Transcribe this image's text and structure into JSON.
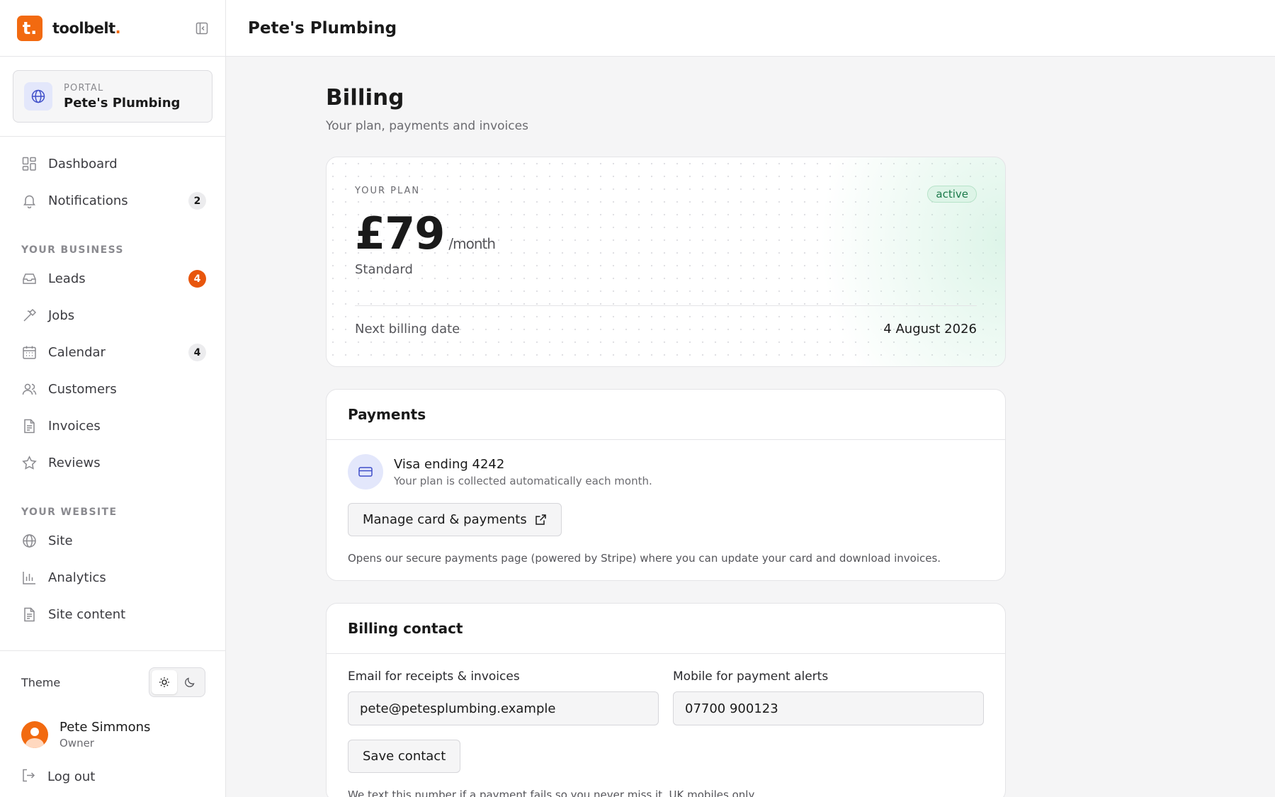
{
  "brand": {
    "logo_letter": "t.",
    "name": "toolbelt",
    "name_dot": ".",
    "accent": "#f26a10"
  },
  "portal": {
    "kicker": "PORTAL",
    "name": "Pete's Plumbing"
  },
  "nav": {
    "main": [
      {
        "label": "Dashboard",
        "icon": "dashboard-icon"
      },
      {
        "label": "Notifications",
        "icon": "bell-icon",
        "badge": "2"
      }
    ],
    "business_heading": "YOUR BUSINESS",
    "business": [
      {
        "label": "Leads",
        "icon": "inbox-icon",
        "badge": "4"
      },
      {
        "label": "Jobs",
        "icon": "hammer-icon"
      },
      {
        "label": "Calendar",
        "icon": "calendar-icon",
        "badge": "4"
      },
      {
        "label": "Customers",
        "icon": "users-icon"
      },
      {
        "label": "Invoices",
        "icon": "file-icon"
      },
      {
        "label": "Reviews",
        "icon": "star-icon"
      }
    ],
    "website_heading": "YOUR WEBSITE",
    "website": [
      {
        "label": "Site",
        "icon": "globe-icon"
      },
      {
        "label": "Analytics",
        "icon": "bar-chart-icon"
      },
      {
        "label": "Site content",
        "icon": "file-icon"
      }
    ]
  },
  "footer": {
    "theme_label": "Theme",
    "user_name": "Pete Simmons",
    "user_role": "Owner",
    "logout_label": "Log out"
  },
  "topbar": {
    "title": "Pete's Plumbing"
  },
  "page": {
    "title": "Billing",
    "subtitle": "Your plan, payments and invoices"
  },
  "plan": {
    "kicker": "YOUR PLAN",
    "status": "active",
    "price": "£79",
    "period": "/month",
    "name": "Standard",
    "next_label": "Next billing date",
    "next_value": "4 August 2026"
  },
  "payments": {
    "title": "Payments",
    "card_title": "Visa ending 4242",
    "card_sub": "Your plan is collected automatically each month.",
    "manage_label": "Manage card & payments",
    "note": "Opens our secure payments page (powered by Stripe) where you can update your card and download invoices."
  },
  "contact": {
    "title": "Billing contact",
    "email_label": "Email for receipts & invoices",
    "email_value": "pete@petesplumbing.example",
    "mobile_label": "Mobile for payment alerts",
    "mobile_value": "07700 900123",
    "save_label": "Save contact",
    "note": "We text this number if a payment fails so you never miss it. UK mobiles only."
  }
}
